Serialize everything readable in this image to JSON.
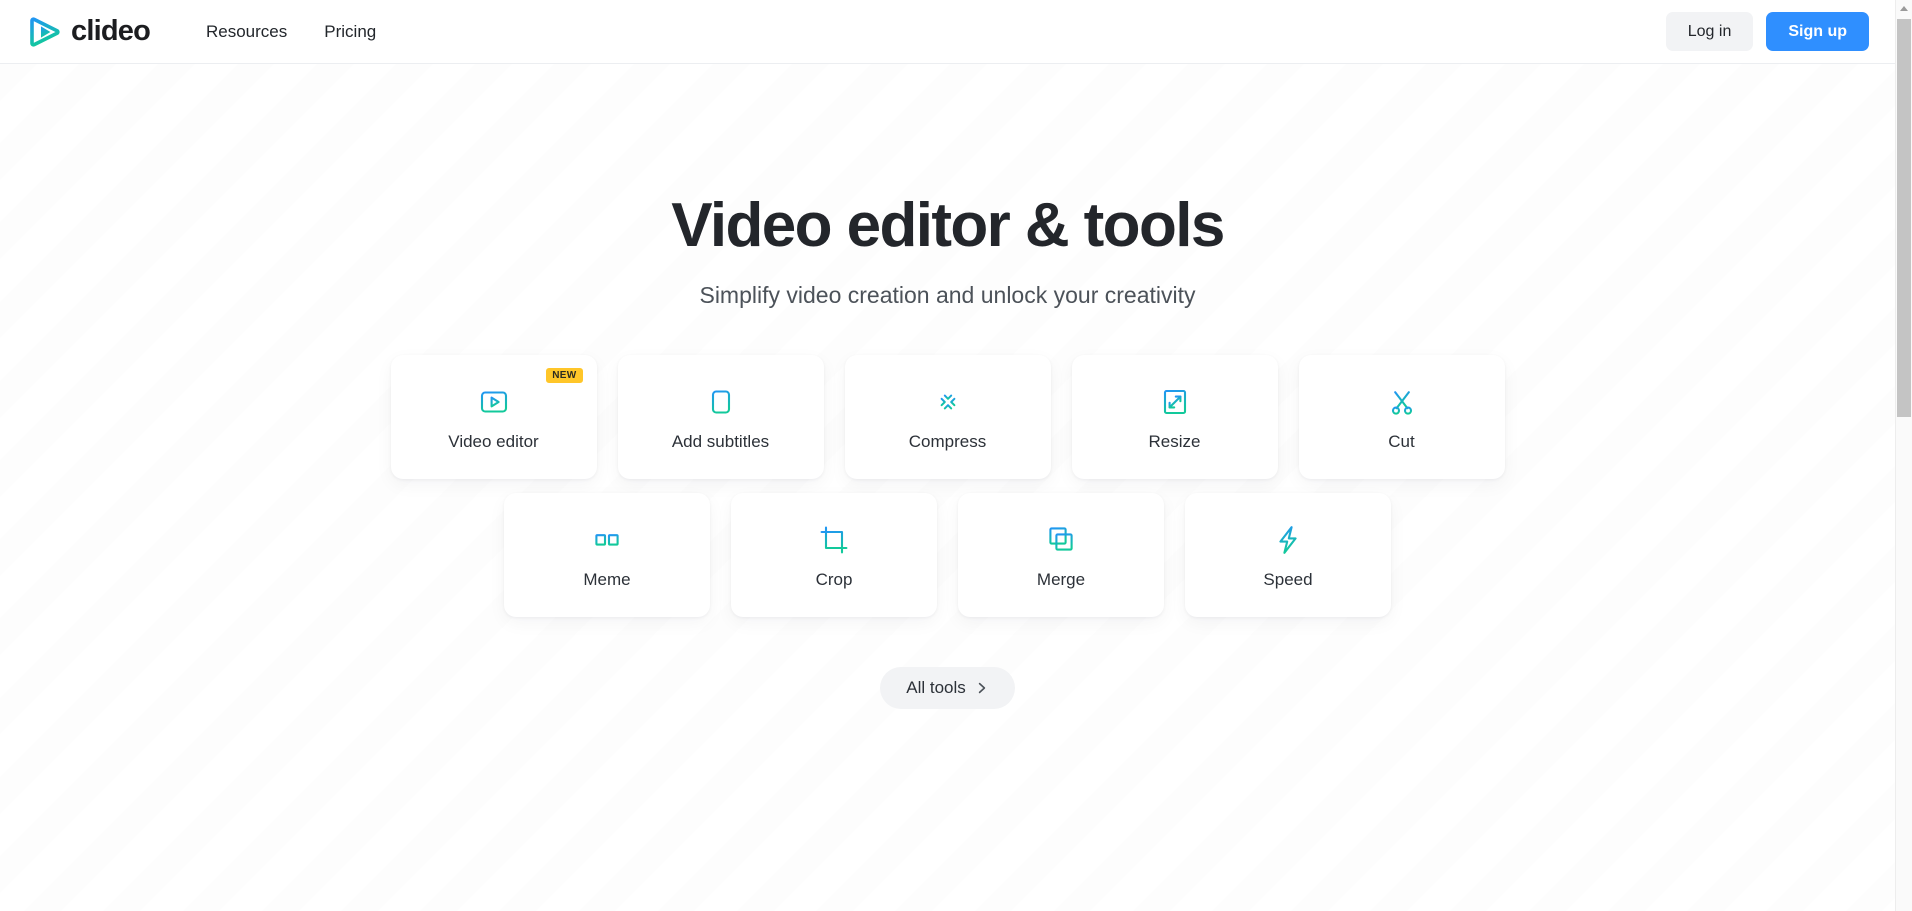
{
  "header": {
    "brand": {
      "name": "clideo",
      "logo_icon": "clideo-play-logo"
    },
    "nav": [
      {
        "label": "Resources",
        "name": "resources"
      },
      {
        "label": "Pricing",
        "name": "pricing"
      }
    ],
    "login_label": "Log in",
    "signup_label": "Sign up"
  },
  "hero": {
    "title": "Video editor & tools",
    "subtitle": "Simplify video creation and unlock your creativity"
  },
  "tools": {
    "row1": [
      {
        "label": "Video editor",
        "icon": "video-editor-play-frame-icon",
        "badge": "NEW"
      },
      {
        "label": "Add subtitles",
        "icon": "subtitles-frame-icon",
        "badge": ""
      },
      {
        "label": "Compress",
        "icon": "compress-arrows-inward-icon",
        "badge": ""
      },
      {
        "label": "Resize",
        "icon": "resize-expand-square-icon",
        "badge": ""
      },
      {
        "label": "Cut",
        "icon": "scissors-icon",
        "badge": ""
      }
    ],
    "row2": [
      {
        "label": "Meme",
        "icon": "meme-glasses-icon",
        "badge": ""
      },
      {
        "label": "Crop",
        "icon": "crop-corners-icon",
        "badge": ""
      },
      {
        "label": "Merge",
        "icon": "merge-overlapping-squares-icon",
        "badge": ""
      },
      {
        "label": "Speed",
        "icon": "speed-lightning-bolt-icon",
        "badge": ""
      }
    ]
  },
  "all_tools": {
    "label": "All tools",
    "icon": "chevron-right-icon"
  },
  "colors": {
    "accent_blue": "#2f8fff",
    "gradient_from": "#2196f3",
    "gradient_to": "#12c99b",
    "badge_yellow": "#ffc629",
    "text_dark": "#23262b",
    "text_muted": "#4c5259",
    "chip_gray": "#f2f3f5"
  }
}
